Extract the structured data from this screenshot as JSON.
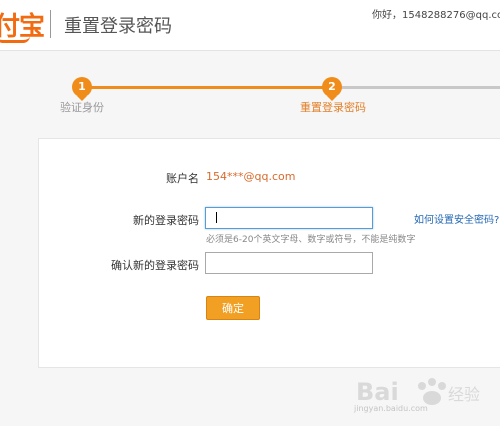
{
  "header": {
    "logo_text": "付宝",
    "title": "重置登录密码",
    "greeting": "你好，1548288276@qq.com",
    "separator": "|"
  },
  "steps": [
    {
      "number": "1",
      "label": "验证身份",
      "state": "done"
    },
    {
      "number": "2",
      "label": "重置登录密码",
      "state": "current"
    }
  ],
  "form": {
    "account_label": "账户名",
    "account_value": "154***@qq.com",
    "new_password_label": "新的登录密码",
    "new_password_value": "",
    "new_password_hint": "必须是6-20个英文字母、数字或符号，不能是纯数字",
    "help_link": "如何设置安全密码?",
    "confirm_password_label": "确认新的登录密码",
    "confirm_password_value": "",
    "submit_label": "确定"
  },
  "watermark": {
    "text": "Baidu 经验",
    "url_text": "jingyan.baidu.com"
  },
  "colors": {
    "accent": "#f08c1a",
    "button": "#f1a023",
    "link": "#2468b3",
    "account": "#d86a2c"
  }
}
